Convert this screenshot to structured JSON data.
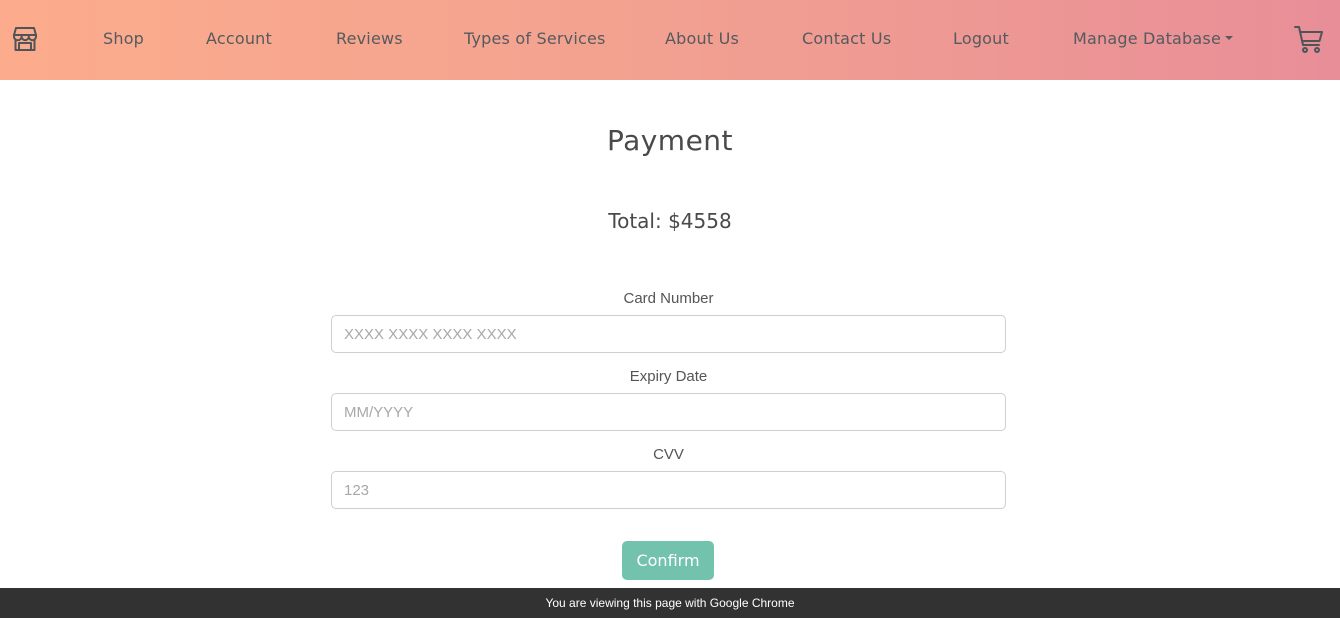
{
  "navbar": {
    "brand_icon": "store-icon",
    "links": [
      {
        "label": "Shop"
      },
      {
        "label": "Account"
      },
      {
        "label": "Reviews"
      },
      {
        "label": "Types of Services"
      },
      {
        "label": "About Us"
      },
      {
        "label": "Contact Us"
      },
      {
        "label": "Logout"
      },
      {
        "label": "Manage Database"
      }
    ],
    "cart_icon": "cart-icon",
    "gradient": [
      "#fcac8c",
      "#e88e98"
    ]
  },
  "page": {
    "title": "Payment",
    "total": "Total: $4558"
  },
  "form": {
    "card_number": {
      "label": "Card Number",
      "placeholder": "XXXX XXXX XXXX XXXX",
      "value": ""
    },
    "expiry": {
      "label": "Expiry Date",
      "placeholder": "MM/YYYY",
      "value": ""
    },
    "cvv": {
      "label": "CVV",
      "placeholder": "123",
      "value": ""
    },
    "confirm_label": "Confirm",
    "confirm_color": "#73c2ad"
  },
  "footer": {
    "notice": "You are viewing this page with Google Chrome"
  }
}
